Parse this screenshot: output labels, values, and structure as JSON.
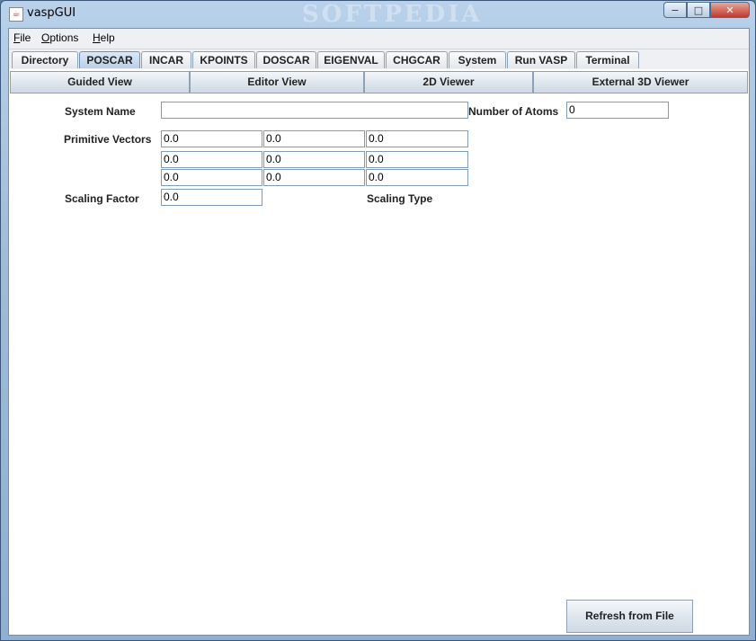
{
  "window": {
    "title": "vaspGUI",
    "watermark": "SOFTPEDIA",
    "controls": {
      "minimize": "−",
      "maximize": "□",
      "close": "✕"
    }
  },
  "menu": [
    {
      "label": "File",
      "mnemonic": "F"
    },
    {
      "label": "Options",
      "mnemonic": "O"
    },
    {
      "label": "Help",
      "mnemonic": "H"
    }
  ],
  "tabs": [
    "Directory",
    "POSCAR",
    "INCAR",
    "KPOINTS",
    "DOSCAR",
    "EIGENVAL",
    "CHGCAR",
    "System",
    "Run VASP",
    "Terminal"
  ],
  "active_tab": "POSCAR",
  "subtabs": [
    "Guided View",
    "Editor View",
    "2D Viewer",
    "External 3D Viewer"
  ],
  "form": {
    "system_name_label": "System Name",
    "system_name_value": "",
    "number_of_atoms_label": "Number of Atoms",
    "number_of_atoms_value": "0",
    "primitive_vectors_label": "Primitive Vectors",
    "primitive_vectors": [
      [
        "0.0",
        "0.0",
        "0.0"
      ],
      [
        "0.0",
        "0.0",
        "0.0"
      ],
      [
        "0.0",
        "0.0",
        "0.0"
      ]
    ],
    "scaling_factor_label": "Scaling Factor",
    "scaling_factor_value": "0.0",
    "scaling_type_label": "Scaling Type"
  },
  "refresh_button": "Refresh from File"
}
